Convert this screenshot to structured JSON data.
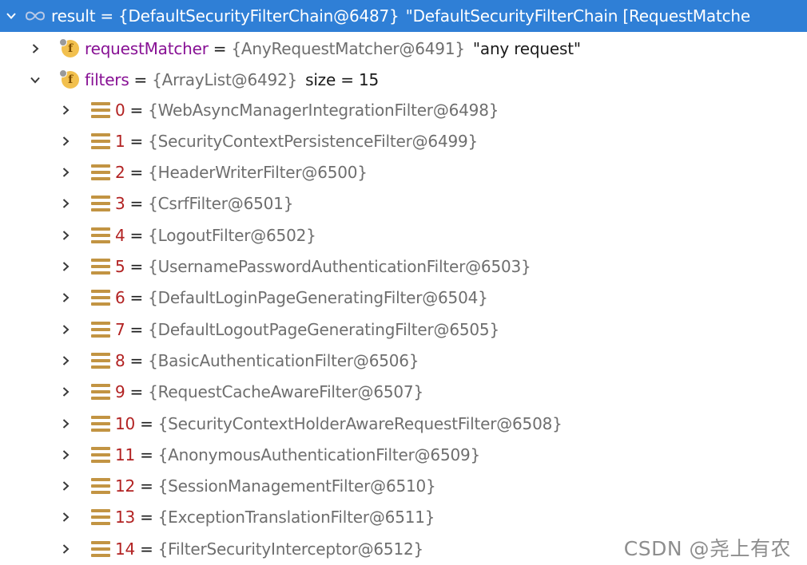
{
  "result": {
    "name": "result",
    "value": "{DefaultSecurityFilterChain@6487}",
    "description": "\"DefaultSecurityFilterChain [RequestMatche"
  },
  "fields": [
    {
      "name": "requestMatcher",
      "value": "{AnyRequestMatcher@6491}",
      "extra": "\"any request\"",
      "expanded": false
    },
    {
      "name": "filters",
      "value": "{ArrayList@6492}",
      "extra": "size = 15",
      "expanded": true
    }
  ],
  "filters": [
    {
      "index": "0",
      "value": "{WebAsyncManagerIntegrationFilter@6498}"
    },
    {
      "index": "1",
      "value": "{SecurityContextPersistenceFilter@6499}"
    },
    {
      "index": "2",
      "value": "{HeaderWriterFilter@6500}"
    },
    {
      "index": "3",
      "value": "{CsrfFilter@6501}"
    },
    {
      "index": "4",
      "value": "{LogoutFilter@6502}"
    },
    {
      "index": "5",
      "value": "{UsernamePasswordAuthenticationFilter@6503}"
    },
    {
      "index": "6",
      "value": "{DefaultLoginPageGeneratingFilter@6504}"
    },
    {
      "index": "7",
      "value": "{DefaultLogoutPageGeneratingFilter@6505}"
    },
    {
      "index": "8",
      "value": "{BasicAuthenticationFilter@6506}"
    },
    {
      "index": "9",
      "value": "{RequestCacheAwareFilter@6507}"
    },
    {
      "index": "10",
      "value": "{SecurityContextHolderAwareRequestFilter@6508}"
    },
    {
      "index": "11",
      "value": "{AnonymousAuthenticationFilter@6509}"
    },
    {
      "index": "12",
      "value": "{SessionManagementFilter@6510}"
    },
    {
      "index": "13",
      "value": "{ExceptionTranslationFilter@6511}"
    },
    {
      "index": "14",
      "value": "{FilterSecurityInterceptor@6512}"
    }
  ],
  "watermark": "CSDN @尧上有农",
  "colors": {
    "selection": "#2f7fd6",
    "field_name": "#871094",
    "index_name": "#b22222",
    "reference_value": "#6e6e6e",
    "field_icon": "#f2c04e",
    "list_icon": "#c29443"
  }
}
